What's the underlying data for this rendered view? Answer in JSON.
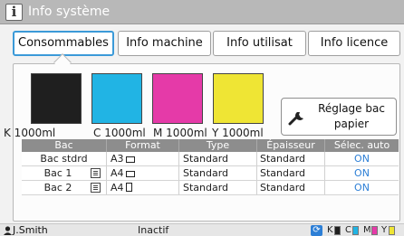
{
  "window": {
    "title": "Info système",
    "title_icon": "info-icon"
  },
  "tabs": [
    {
      "label": "Consommables",
      "active": true
    },
    {
      "label": "Info machine",
      "active": false
    },
    {
      "label": "Info utilisat",
      "active": false
    },
    {
      "label": "Info licence",
      "active": false
    }
  ],
  "inks": [
    {
      "letter": "K",
      "volume": "1000ml",
      "label": "K  1000ml",
      "color": "#1f1f1f"
    },
    {
      "letter": "C",
      "volume": "1000ml",
      "label": "C  1000ml",
      "color": "#21b4e4"
    },
    {
      "letter": "M",
      "volume": "1000ml",
      "label": "M  1000ml",
      "color": "#e53aa8"
    },
    {
      "letter": "Y",
      "volume": "1000ml",
      "label": "Y  1000ml",
      "color": "#efe534"
    }
  ],
  "reglage_button": {
    "line1": "Réglage bac",
    "line2": "papier",
    "icon": "wrench-icon"
  },
  "table": {
    "headers": [
      "Bac",
      "Format",
      "Type",
      "Épaisseur",
      "Sélec. auto"
    ],
    "rows": [
      {
        "bac": "Bac stdrd",
        "tray_icon": false,
        "format": "A3",
        "orientation": "landscape",
        "type": "Standard",
        "epaisseur": "Standard",
        "auto": "ON"
      },
      {
        "bac": "Bac 1",
        "tray_icon": true,
        "format": "A4",
        "orientation": "landscape",
        "type": "Standard",
        "epaisseur": "Standard",
        "auto": "ON"
      },
      {
        "bac": "Bac 2",
        "tray_icon": true,
        "format": "A4",
        "orientation": "portrait",
        "type": "Standard",
        "epaisseur": "Standard",
        "auto": "ON"
      }
    ]
  },
  "status": {
    "user": "J.Smith",
    "user_icon": "user-icon",
    "state": "Inactif",
    "refresh_icon": "refresh-icon",
    "ink_mini": [
      {
        "letter": "K",
        "color": "#1f1f1f"
      },
      {
        "letter": "C",
        "color": "#21b4e4"
      },
      {
        "letter": "M",
        "color": "#e53aa8"
      },
      {
        "letter": "Y",
        "color": "#efe534"
      }
    ]
  },
  "colors": {
    "accent": "#3b9ad8",
    "on_text": "#2d7fd6",
    "titlebar": "#b8b8b8",
    "table_header": "#8d8d8d"
  }
}
